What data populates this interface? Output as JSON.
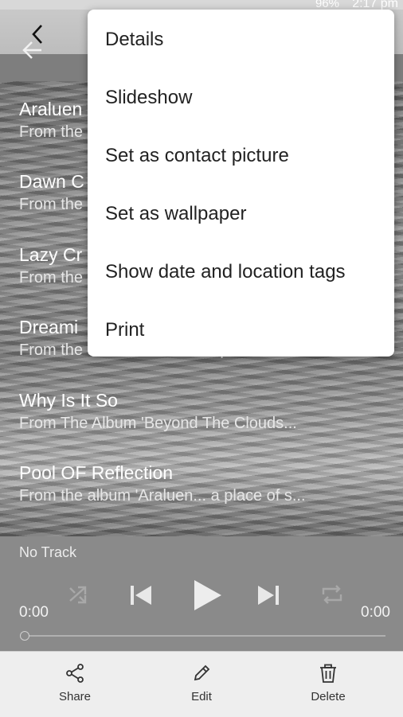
{
  "status_bar": {
    "battery": "96%",
    "time": "2:17 pm"
  },
  "tracks": [
    {
      "title": "Araluen",
      "subtitle": "From the"
    },
    {
      "title": "Dawn C",
      "subtitle": "From the"
    },
    {
      "title": "Lazy Cr",
      "subtitle": "From the"
    },
    {
      "title": "Dreami",
      "subtitle": "From the album Araluen... a place of s..."
    },
    {
      "title": "Why Is It So",
      "subtitle": "From The Album 'Beyond The Clouds..."
    },
    {
      "title": "Pool OF Reflection",
      "subtitle": "From the album 'Araluen... a place of s..."
    }
  ],
  "player": {
    "now_playing": "No Track",
    "elapsed": "0:00",
    "duration": "0:00"
  },
  "menu": {
    "items": [
      "Details",
      "Slideshow",
      "Set as contact picture",
      "Set as wallpaper",
      "Show date and location tags",
      "Print"
    ]
  },
  "bottom_bar": {
    "share": "Share",
    "edit": "Edit",
    "delete": "Delete"
  }
}
